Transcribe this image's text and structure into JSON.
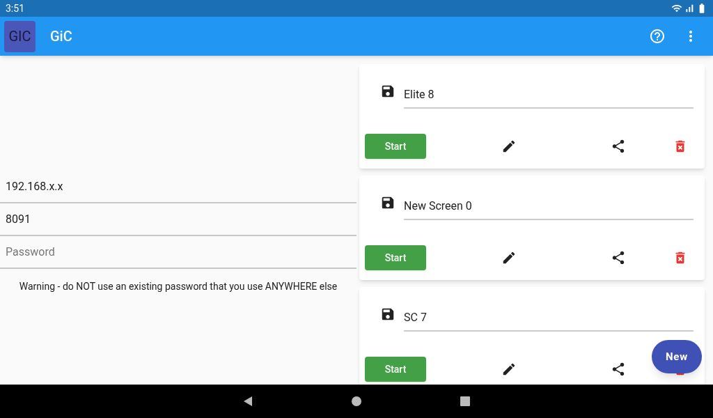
{
  "status_bar": {
    "time": "3:51"
  },
  "app_bar": {
    "logo": "GIC",
    "title": "GiC"
  },
  "connection": {
    "host": {
      "value": "192.168.x.x"
    },
    "port": {
      "value": "8091"
    },
    "password": {
      "placeholder": "Password"
    },
    "warning": "Warning - do NOT use an existing password that you use ANYWHERE else"
  },
  "screens": [
    {
      "name": "Elite 8",
      "start": "Start"
    },
    {
      "name": "New Screen 0",
      "start": "Start"
    },
    {
      "name": "SC 7",
      "start": "Start"
    }
  ],
  "fab": "New"
}
